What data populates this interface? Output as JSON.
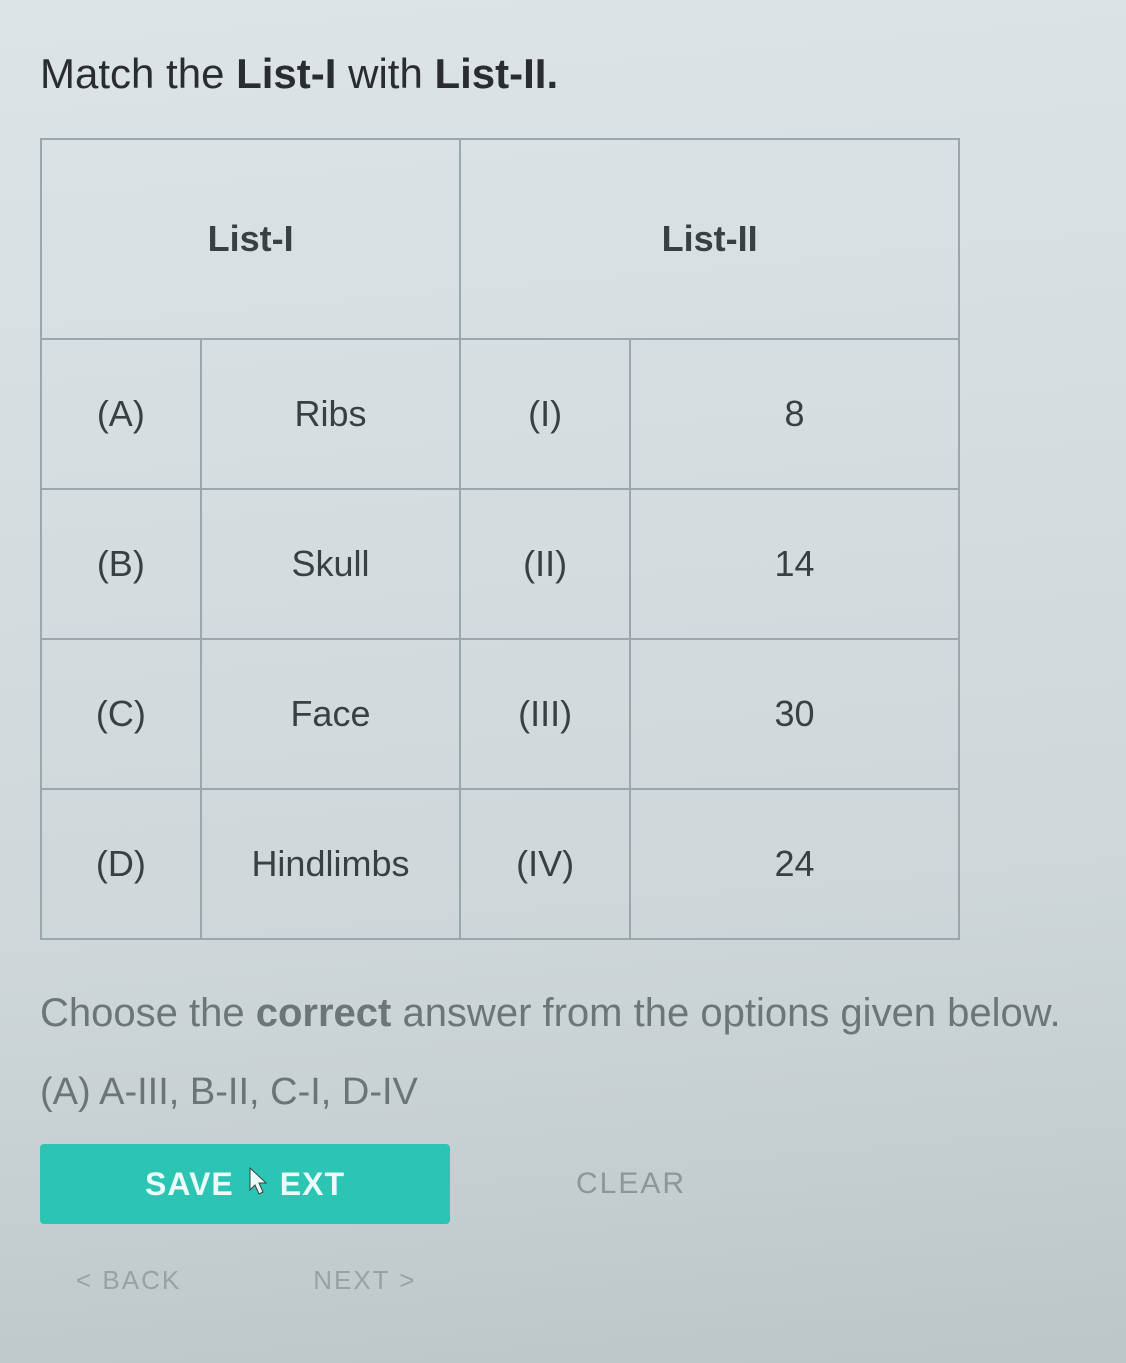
{
  "question": {
    "prefix": "Match the ",
    "bold1": "List-I",
    "mid": " with ",
    "bold2": "List-II."
  },
  "table": {
    "headers": {
      "list1": "List-I",
      "list2": "List-II"
    },
    "rows": [
      {
        "k1": "(A)",
        "v1": "Ribs",
        "k2": "(I)",
        "v2": "8"
      },
      {
        "k1": "(B)",
        "v1": "Skull",
        "k2": "(II)",
        "v2": "14"
      },
      {
        "k1": "(C)",
        "v1": "Face",
        "k2": "(III)",
        "v2": "30"
      },
      {
        "k1": "(D)",
        "v1": "Hindlimbs",
        "k2": "(IV)",
        "v2": "24"
      }
    ]
  },
  "instruction": {
    "pre": "Choose the ",
    "bold": "correct",
    "post": " answer from the options given below."
  },
  "option_a": "(A) A-III,    B-II,    C-I,    D-IV",
  "buttons": {
    "save_pre": "SAVE",
    "save_post": "EXT",
    "clear": "CLEAR",
    "back": "< BACK",
    "next": "NEXT >"
  }
}
